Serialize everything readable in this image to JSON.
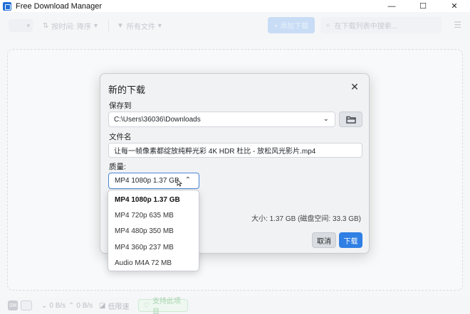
{
  "window": {
    "title": "Free Download Manager",
    "minimize_glyph": "—",
    "maximize_glyph": "☐",
    "close_glyph": "✕"
  },
  "toolbar": {
    "sort_label": "按时间: 降序",
    "filter_label": "所有文件",
    "new_download_label": "+ 添加下载",
    "search_placeholder": "在下载列表中搜索..."
  },
  "dialog": {
    "title": "新的下载",
    "save_to_label": "保存到",
    "save_path": "C:\\Users\\36036\\Downloads",
    "filename_label": "文件名",
    "filename": "让每一帧像素都绽放纯粹光彩 4K HDR 杜比 - 放松风光影片.mp4",
    "quality_label": "质量:",
    "quality_selected": "MP4 1080p 1.37 GB",
    "size_info": "大小: 1.37 GB (磁盘空间: 33.3 GB)",
    "cancel_label": "取消",
    "download_label": "下载"
  },
  "quality_options": [
    {
      "label": "MP4 1080p 1.37 GB",
      "selected": true
    },
    {
      "label": "MP4 720p 635 MB",
      "selected": false
    },
    {
      "label": "MP4 480p 350 MB",
      "selected": false
    },
    {
      "label": "MP4 360p 237 MB",
      "selected": false
    },
    {
      "label": "Audio M4A  72 MB",
      "selected": false
    }
  ],
  "statusbar": {
    "badge": "SM",
    "download_speed": "0 B/s",
    "upload_speed": "0 B/s",
    "speed_mode": "低限速",
    "support_label": "支持此项目"
  },
  "colors": {
    "accent": "#2f7fe4",
    "select_border": "#4a86d6"
  }
}
